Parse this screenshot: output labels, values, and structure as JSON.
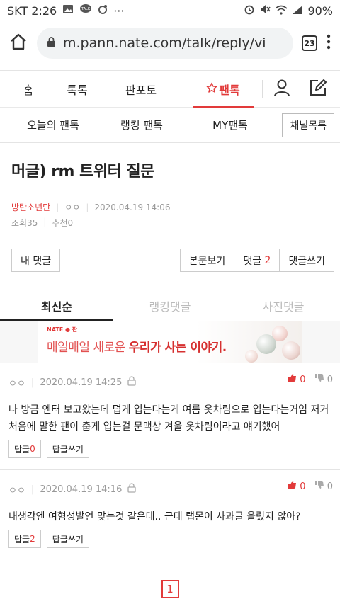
{
  "status_bar": {
    "carrier_time": "SKT 2:26",
    "more": "···",
    "battery": "90%"
  },
  "browser": {
    "url": "m.pann.nate.com/talk/reply/vi",
    "tab_count": "23"
  },
  "gnb": {
    "tabs": [
      "홈",
      "톡톡",
      "판포토",
      "팬톡"
    ]
  },
  "subnav": {
    "items": [
      "오늘의 팬톡",
      "랭킹 팬톡",
      "MY팬톡"
    ],
    "channel_button": "채널목록"
  },
  "post": {
    "title": "머글) rm 트위터 질문",
    "category": "방탄소년단",
    "author": "ㅇㅇ",
    "datetime": "2020.04.19 14:06",
    "views": "조회35",
    "recommend": "추천0"
  },
  "actions": {
    "my_comments": "내 댓글",
    "view_post": "본문보기",
    "comments_label": "댓글",
    "comments_count": "2",
    "write_comment": "댓글쓰기"
  },
  "sort_tabs": [
    "최신순",
    "랭킹댓글",
    "사진댓글"
  ],
  "banner": {
    "brand": "NATE ● 판",
    "text_plain": "매일매일 새로운 ",
    "text_bold": "우리가 사는 이야기."
  },
  "comments": [
    {
      "author": "ㅇㅇ",
      "datetime": "2020.04.19 14:25",
      "likes": "0",
      "dislikes": "0",
      "body": "나 방금 엔터 보고왔는데 덥게 입는다는게 여름 옷차림으로 입는다는거임 저거 처음에 말한 팬이 춥게 입는걸 문맥상 겨울 옷차림이라고 얘기했어",
      "reply_label": "답글",
      "reply_count": "0",
      "write_reply": "답글쓰기"
    },
    {
      "author": "ㅇㅇ",
      "datetime": "2020.04.19 14:16",
      "likes": "0",
      "dislikes": "0",
      "body": "내생각엔 여혐성발언 맞는것 같은데.. 근데 랩몬이 사과글 올렸지 않아?",
      "reply_label": "답글",
      "reply_count": "2",
      "write_reply": "답글쓰기"
    }
  ],
  "pagination": {
    "current": "1"
  },
  "colors": {
    "accent": "#e23a3a",
    "border": "#e4e4e4",
    "muted": "#999999"
  }
}
